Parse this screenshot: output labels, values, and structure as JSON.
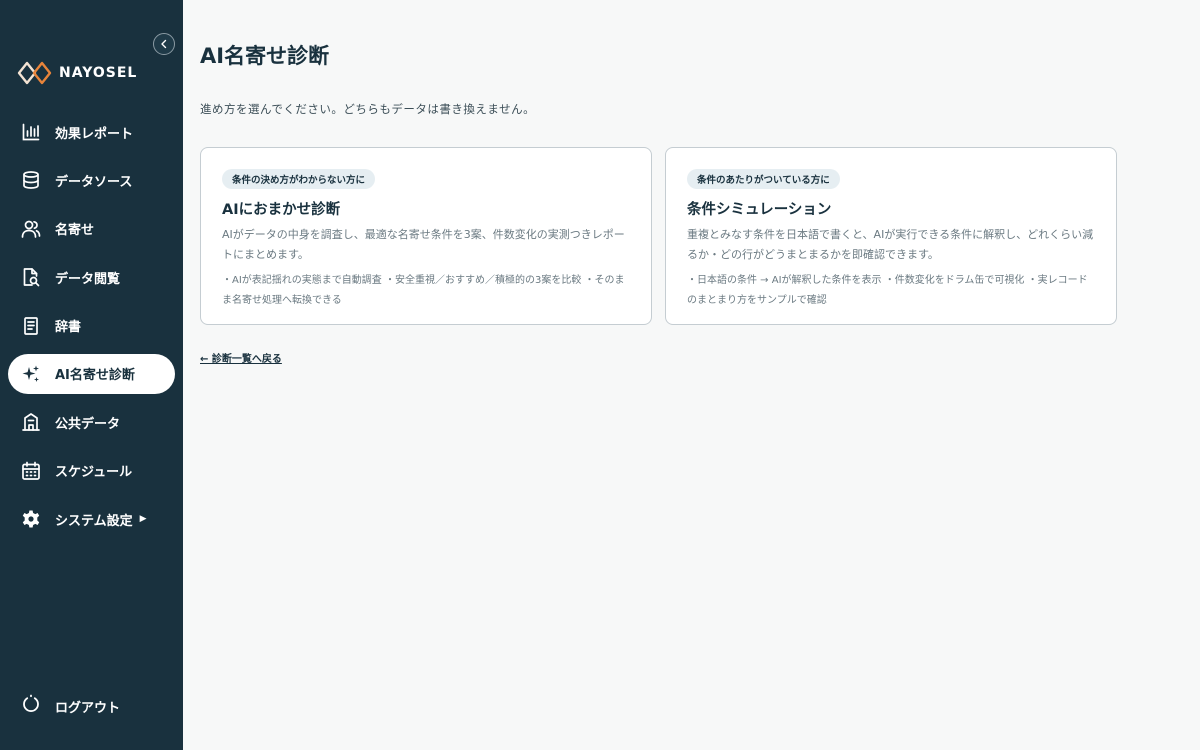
{
  "app": {
    "logo_text": "NAYOSEL"
  },
  "sidebar": {
    "items": [
      {
        "label": "効果レポート",
        "icon": "bar-chart-icon"
      },
      {
        "label": "データソース",
        "icon": "database-icon"
      },
      {
        "label": "名寄せ",
        "icon": "users-icon"
      },
      {
        "label": "データ閲覧",
        "icon": "file-search-icon"
      },
      {
        "label": "辞書",
        "icon": "book-icon"
      },
      {
        "label": "AI名寄せ診断",
        "icon": "sparkle-icon",
        "active": true
      },
      {
        "label": "公共データ",
        "icon": "building-icon"
      },
      {
        "label": "スケジュール",
        "icon": "calendar-icon"
      },
      {
        "label": "システム設定",
        "icon": "gear-icon",
        "caret": "▶"
      }
    ],
    "logout_label": "ログアウト"
  },
  "main": {
    "title": "AI名寄せ診断",
    "subtitle": "進め方を選んでください。どちらもデータは書き換えません。",
    "cards": [
      {
        "tag": "条件の決め方がわからない方に",
        "title": "AIにおまかせ診断",
        "description": "AIがデータの中身を調査し、最適な名寄せ条件を3案、件数変化の実測つきレポートにまとめます。",
        "bullets": "・AIが表記揺れの実態まで自動調査 ・安全重視／おすすめ／積極的の3案を比較 ・そのまま名寄せ処理へ転換できる"
      },
      {
        "tag": "条件のあたりがついている方に",
        "title": "条件シミュレーション",
        "description": "重複とみなす条件を日本語で書くと、AIが実行できる条件に解釈し、どれくらい減るか・どの行がどうまとまるかを即確認できます。",
        "bullets": "・日本語の条件 → AIが解釈した条件を表示 ・件数変化をドラム缶で可視化 ・実レコードのまとまり方をサンプルで確認"
      }
    ],
    "back_link": "← 診断一覧へ戻る"
  },
  "colors": {
    "sidebar_bg": "#19313e",
    "page_bg": "#f7f8f8",
    "logo_orange": "#e8843a",
    "logo_light": "#f3e3d3"
  }
}
